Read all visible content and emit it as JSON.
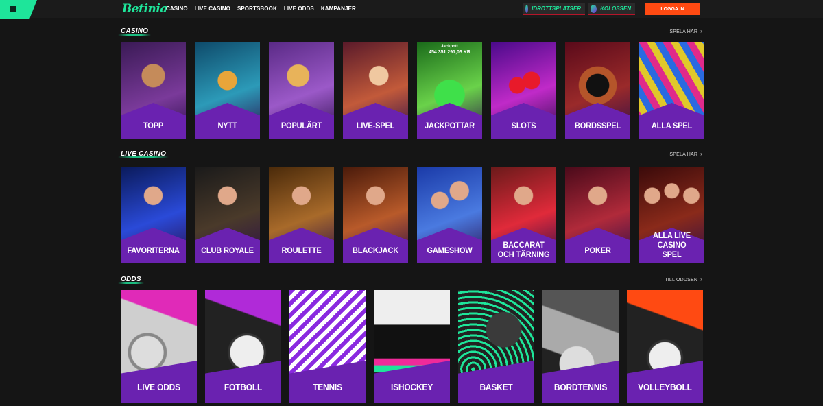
{
  "header": {
    "logo": "Betinia",
    "nav": [
      "CASINO",
      "LIVE CASINO",
      "SPORTSBOOK",
      "LIVE ODDS",
      "KAMPANJER"
    ],
    "pills": [
      "IDROTTSPLATSER",
      "KOLOSSEN"
    ],
    "login": "LOGGA IN"
  },
  "casino": {
    "title": "CASINO",
    "more": "SPELA HÄR",
    "cards": [
      "TOPP",
      "NYTT",
      "POPULÄRT",
      "LIVE-SPEL",
      "JACKPOTTAR",
      "SLOTS",
      "BORDSSPEL",
      "ALLA SPEL"
    ],
    "jackpot_label": "Jackpott",
    "jackpot_value": "454 351 291,03 KR"
  },
  "live_casino": {
    "title": "LIVE CASINO",
    "more": "SPELA HÄR",
    "cards": [
      "FAVORITERNA",
      "CLUB ROYALE",
      "ROULETTE",
      "BLACKJACK",
      "GAMESHOW",
      "BACCARAT OCH TÄRNING",
      "POKER",
      "ALLA LIVE CASINO SPEL"
    ]
  },
  "odds": {
    "title": "ODDS",
    "more": "TILL ODDSEN",
    "cards": [
      "LIVE ODDS",
      "FOTBOLL",
      "TENNIS",
      "ISHOCKEY",
      "BASKET",
      "BORDTENNIS",
      "VOLLEYBOLL"
    ]
  },
  "colors": {
    "accent": "#1ee59a",
    "login": "#ff4a12",
    "card_band": "#6a22b0",
    "background": "#151515"
  },
  "icons": [
    "menu-icon",
    "chevron-right-icon"
  ]
}
